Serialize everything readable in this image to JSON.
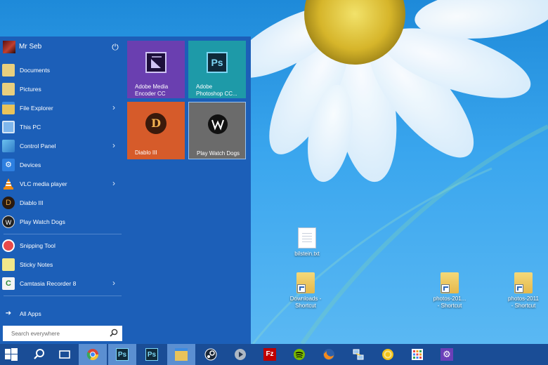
{
  "user": {
    "name": "Mr Seb",
    "power_icon": "⏻"
  },
  "menu_items": [
    {
      "label": "Documents",
      "icon": "documents-icon",
      "has_arrow": false
    },
    {
      "label": "Pictures",
      "icon": "pictures-icon",
      "has_arrow": false
    },
    {
      "label": "File Explorer",
      "icon": "file-explorer-icon",
      "has_arrow": true
    },
    {
      "label": "This PC",
      "icon": "this-pc-icon",
      "has_arrow": false
    },
    {
      "label": "Control Panel",
      "icon": "control-panel-icon",
      "has_arrow": true
    },
    {
      "label": "Devices",
      "icon": "devices-gear-icon",
      "has_arrow": false
    },
    {
      "label": "VLC media player",
      "icon": "vlc-cone-icon",
      "has_arrow": true
    },
    {
      "label": "Diablo III",
      "icon": "diablo-icon",
      "has_arrow": false
    },
    {
      "label": "Play Watch Dogs",
      "icon": "watch-dogs-icon",
      "has_arrow": false
    },
    {
      "label": "Snipping Tool",
      "icon": "snipping-tool-icon",
      "has_arrow": false
    },
    {
      "label": "Sticky Notes",
      "icon": "sticky-notes-icon",
      "has_arrow": false
    },
    {
      "label": "Camtasia Recorder 8",
      "icon": "camtasia-icon",
      "has_arrow": true
    }
  ],
  "arrow_glyph": "›",
  "all_apps": {
    "label": "All Apps",
    "glyph": "➔"
  },
  "search": {
    "placeholder": "Search everywhere"
  },
  "tiles": [
    {
      "line1": "Adobe Media",
      "line2": "Encoder CC",
      "color": "#6a3fb0",
      "icon": "media-encoder-icon"
    },
    {
      "line1": "Adobe",
      "line2": "Photoshop CC...",
      "color": "#1e9aa8",
      "icon": "photoshop-icon",
      "icon_text": "Ps"
    },
    {
      "line1": "Diablo III",
      "line2": "",
      "color": "#d65b2a",
      "icon": "diablo-icon",
      "icon_text": "D"
    },
    {
      "line1": "Play Watch Dogs",
      "line2": "",
      "color": "#6b6b6b",
      "icon": "watch-dogs-icon"
    }
  ],
  "desktop_icons": [
    {
      "label": "bilstein.txt",
      "label2": "",
      "type": "file"
    },
    {
      "label": "Downloads -",
      "label2": "Shortcut",
      "type": "folder"
    },
    {
      "label": "photos-201...",
      "label2": "- Shortcut",
      "type": "folder"
    },
    {
      "label": "photos-2011",
      "label2": "- Shortcut",
      "type": "folder"
    }
  ],
  "taskbar": [
    {
      "name": "start-windows-icon"
    },
    {
      "name": "search-icon"
    },
    {
      "name": "task-view-icon"
    },
    {
      "name": "chrome-icon",
      "active": true
    },
    {
      "name": "photoshop-icon",
      "text": "Ps",
      "active": true
    },
    {
      "name": "photoshop-icon-2",
      "text": "Ps"
    },
    {
      "name": "file-explorer-icon",
      "active": true
    },
    {
      "name": "steam-icon"
    },
    {
      "name": "media-player-icon"
    },
    {
      "name": "filezilla-icon",
      "text": "Fz"
    },
    {
      "name": "spotify-icon"
    },
    {
      "name": "firefox-icon"
    },
    {
      "name": "network-icon"
    },
    {
      "name": "norton-icon"
    },
    {
      "name": "apps-grid-icon"
    },
    {
      "name": "settings-gear-icon"
    }
  ],
  "colors": {
    "start_bg": "#1c5fb8",
    "taskbar_bg": "#1a4d96",
    "taskbar_active": "#5b8fd1",
    "tile_media_encoder": "#6a3fb0",
    "tile_photoshop": "#1e9aa8",
    "tile_diablo": "#d65b2a",
    "tile_watchdogs": "#6b6b6b"
  }
}
